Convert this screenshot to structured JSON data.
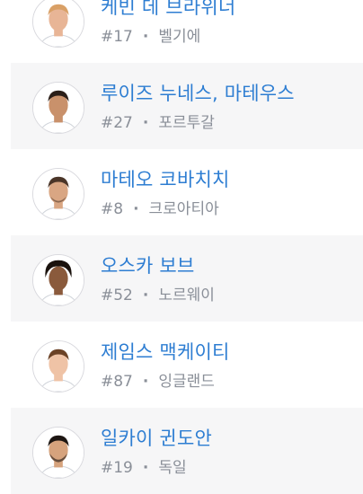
{
  "separator": "·",
  "players": [
    {
      "name": "케빈 데 브라위너",
      "number": "#17",
      "country": "벨기에",
      "skin": "#e8b596",
      "hair": "#d9a066",
      "shirt": "#ffffff"
    },
    {
      "name": "루이즈 누네스, 마테우스",
      "number": "#27",
      "country": "포르투갈",
      "skin": "#c9916b",
      "hair": "#2a1e18",
      "shirt": "#ffffff"
    },
    {
      "name": "마테오 코바치치",
      "number": "#8",
      "country": "크로아티아",
      "skin": "#d9a683",
      "hair": "#4a3528",
      "shirt": "#ffffff"
    },
    {
      "name": "오스카 보브",
      "number": "#52",
      "country": "노르웨이",
      "skin": "#8a5a3c",
      "hair": "#1a120d",
      "shirt": "#ffffff"
    },
    {
      "name": "제임스 맥케이티",
      "number": "#87",
      "country": "잉글랜드",
      "skin": "#efc3a6",
      "hair": "#6b4226",
      "shirt": "#ffffff"
    },
    {
      "name": "일카이 귄도안",
      "number": "#19",
      "country": "독일",
      "skin": "#d6a37d",
      "hair": "#1d1612",
      "shirt": "#ffffff"
    }
  ]
}
